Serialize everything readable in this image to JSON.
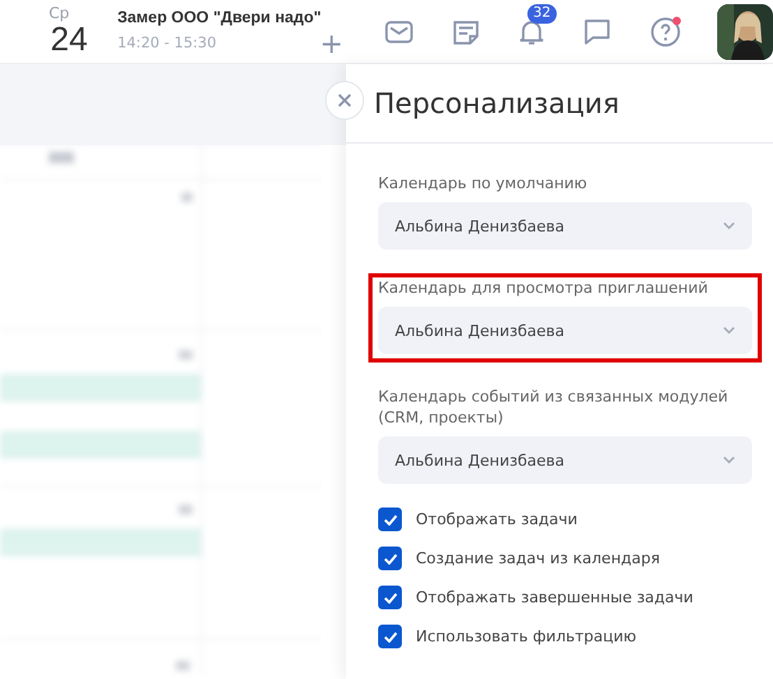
{
  "header": {
    "weekday": "Ср",
    "day": "24",
    "event": {
      "title": "Замер ООО \"Двери надо\"",
      "time": "14:20 - 15:30",
      "add": "+"
    },
    "notifications": {
      "count": "32"
    },
    "help": {
      "has_alert": true
    }
  },
  "panel": {
    "title": "Персонализация",
    "selects": [
      {
        "label": "Календарь по умолчанию",
        "value": "Альбина Денизбаева",
        "highlighted": false
      },
      {
        "label": "Календарь для просмотра приглашений",
        "value": "Альбина Денизбаева",
        "highlighted": true
      },
      {
        "label": "Календарь событий из связанных модулей (CRM, проекты)",
        "value": "Альбина Денизбаева",
        "highlighted": false
      }
    ],
    "options": [
      {
        "label": "Отображать задачи",
        "checked": true
      },
      {
        "label": "Создание задач из календаря",
        "checked": true
      },
      {
        "label": "Отображать завершенные задачи",
        "checked": true
      },
      {
        "label": "Использовать фильтрацию",
        "checked": true
      }
    ]
  }
}
